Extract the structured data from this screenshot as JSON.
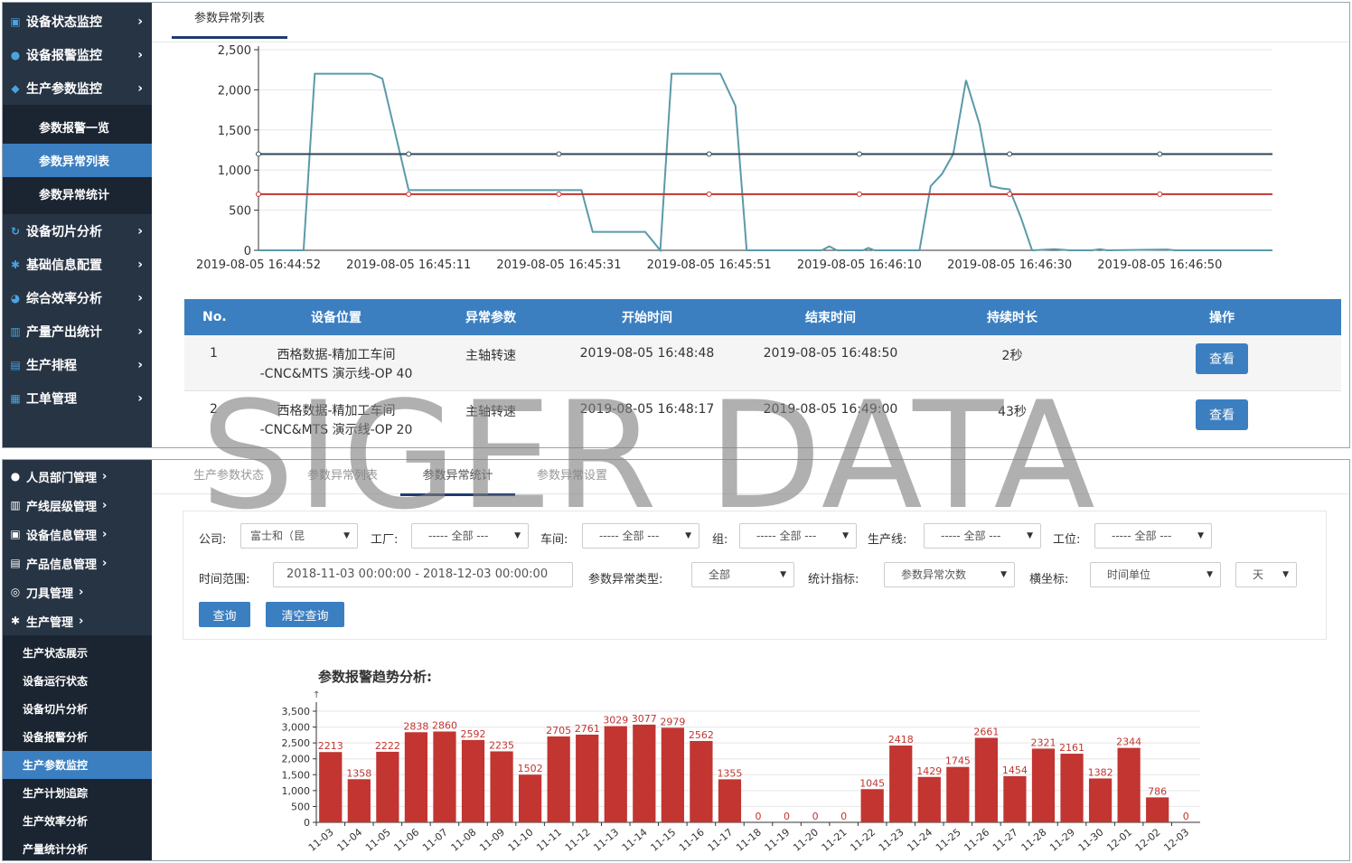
{
  "top": {
    "sidebar": {
      "items": [
        {
          "label": "设备状态监控"
        },
        {
          "label": "设备报警监控"
        },
        {
          "label": "生产参数监控"
        }
      ],
      "subitems": [
        {
          "label": "参数报警一览"
        },
        {
          "label": "参数异常列表"
        },
        {
          "label": "参数异常统计"
        }
      ],
      "items2": [
        {
          "label": "设备切片分析"
        },
        {
          "label": "基础信息配置"
        },
        {
          "label": "综合效率分析"
        },
        {
          "label": "产量产出统计"
        },
        {
          "label": "生产排程"
        },
        {
          "label": "工单管理"
        }
      ]
    },
    "tab": {
      "label": "参数异常列表"
    },
    "chart_data": {
      "type": "line",
      "y_ticks": [
        "2,500",
        "2,000",
        "1,500",
        "1,000",
        "500",
        "0"
      ],
      "ylim": [
        0,
        2500
      ],
      "x_ticks": [
        "2019-08-05 16:44:52",
        "2019-08-05 16:45:11",
        "2019-08-05 16:45:31",
        "2019-08-05 16:45:51",
        "2019-08-05 16:46:10",
        "2019-08-05 16:46:30",
        "2019-08-05 16:46:50"
      ],
      "series": [
        {
          "color": "#5b9aa8",
          "points": [
            [
              0,
              0
            ],
            [
              0.6,
              0
            ],
            [
              0.75,
              2200
            ],
            [
              1.5,
              2200
            ],
            [
              1.65,
              2140
            ],
            [
              2.0,
              750
            ],
            [
              4.3,
              750
            ],
            [
              4.45,
              230
            ],
            [
              5.15,
              230
            ],
            [
              5.35,
              0
            ],
            [
              5.5,
              2200
            ],
            [
              6.15,
              2200
            ],
            [
              6.35,
              1800
            ],
            [
              6.5,
              0
            ],
            [
              7.5,
              0
            ],
            [
              7.6,
              50
            ],
            [
              7.7,
              0
            ],
            [
              8.05,
              0
            ],
            [
              8.12,
              30
            ],
            [
              8.2,
              0
            ],
            [
              8.8,
              0
            ],
            [
              8.95,
              800
            ],
            [
              9.1,
              950
            ],
            [
              9.25,
              1200
            ],
            [
              9.42,
              2120
            ],
            [
              9.6,
              1570
            ],
            [
              9.75,
              800
            ],
            [
              9.9,
              770
            ],
            [
              10.0,
              760
            ],
            [
              10.15,
              410
            ],
            [
              10.3,
              0
            ],
            [
              10.6,
              15
            ],
            [
              10.8,
              0
            ],
            [
              11.1,
              0
            ],
            [
              11.2,
              15
            ],
            [
              11.3,
              0
            ],
            [
              12.1,
              10
            ],
            [
              12.2,
              0
            ],
            [
              13.5,
              0
            ]
          ]
        },
        {
          "color": "#2f4554",
          "flat": 1200
        },
        {
          "color": "#c23531",
          "flat": 700
        }
      ],
      "x_count": 13.5
    },
    "table": {
      "headers": [
        "No.",
        "设备位置",
        "异常参数",
        "开始时间",
        "结束时间",
        "持续时长",
        "操作"
      ],
      "rows": [
        {
          "no": "1",
          "loc1": "西格数据-精加工车间",
          "loc2": "-CNC&MTS 演示线-OP 40",
          "param": "主轴转速",
          "start": "2019-08-05 16:48:48",
          "end": "2019-08-05 16:48:50",
          "dur": "2秒",
          "action": "查看"
        },
        {
          "no": "2",
          "loc1": "西格数据-精加工车间",
          "loc2": "-CNC&MTS 演示线-OP 20",
          "param": "主轴转速",
          "start": "2019-08-05 16:48:17",
          "end": "2019-08-05 16:49:00",
          "dur": "43秒",
          "action": "查看"
        }
      ]
    }
  },
  "bottom": {
    "sidebar": {
      "items": [
        {
          "label": "人员部门管理"
        },
        {
          "label": "产线层级管理"
        },
        {
          "label": "设备信息管理"
        },
        {
          "label": "产品信息管理"
        },
        {
          "label": "刀具管理"
        },
        {
          "label": "生产管理"
        }
      ],
      "subitems": [
        {
          "label": "生产状态展示"
        },
        {
          "label": "设备运行状态"
        },
        {
          "label": "设备切片分析"
        },
        {
          "label": "设备报警分析"
        },
        {
          "label": "生产参数监控"
        },
        {
          "label": "生产计划追踪"
        },
        {
          "label": "生产效率分析"
        },
        {
          "label": "产量统计分析"
        }
      ]
    },
    "tabs": [
      "生产参数状态",
      "参数异常列表",
      "参数异常统计",
      "参数异常设置"
    ],
    "filters": {
      "company_label": "公司:",
      "company_value": "富士和（昆",
      "factory_label": "工厂:",
      "factory_value": "----- 全部 ---",
      "workshop_label": "车间:",
      "workshop_value": "----- 全部 ---",
      "group_label": "组:",
      "group_value": "----- 全部 ---",
      "line_label": "生产线:",
      "line_value": "----- 全部 ---",
      "station_label": "工位:",
      "station_value": "----- 全部 ---",
      "time_label": "时间范围:",
      "time_value": "2018-11-03 00:00:00 - 2018-12-03 00:00:00",
      "type_label": "参数异常类型:",
      "type_value": "全部",
      "metric_label": "统计指标:",
      "metric_value": "参数异常次数",
      "xaxis_label": "横坐标:",
      "xaxis_value": "时间单位",
      "unit_value": "天",
      "query": "查询",
      "clear": "清空查询"
    },
    "chart_data": {
      "type": "bar",
      "title": "参数报警趋势分析:",
      "ylim": [
        0,
        3500
      ],
      "y_ticks": [
        "3,500",
        "3,000",
        "2,500",
        "2,000",
        "1,500",
        "1,000",
        "500",
        "0"
      ],
      "color": "#c23531",
      "categories": [
        "11-03",
        "11-04",
        "11-05",
        "11-06",
        "11-07",
        "11-08",
        "11-09",
        "11-10",
        "11-11",
        "11-12",
        "11-13",
        "11-14",
        "11-15",
        "11-16",
        "11-17",
        "11-18",
        "11-19",
        "11-20",
        "11-21",
        "11-22",
        "11-23",
        "11-24",
        "11-25",
        "11-26",
        "11-27",
        "11-28",
        "11-29",
        "11-30",
        "12-01",
        "12-02",
        "12-03"
      ],
      "values": [
        2213,
        1358,
        2222,
        2838,
        2860,
        2592,
        2235,
        1502,
        2705,
        2761,
        3029,
        3077,
        2979,
        2562,
        1355,
        0,
        0,
        0,
        0,
        1045,
        2418,
        1429,
        1745,
        2661,
        1454,
        2321,
        2161,
        1382,
        2344,
        786,
        0
      ],
      "labels": [
        "2213",
        "1358",
        "2222",
        "2838",
        "2860",
        "2592",
        "2235",
        "1502",
        "2705",
        "2761",
        "3029",
        "3077",
        "2979",
        "2562",
        "1355",
        "0",
        "0",
        "0",
        "0",
        "1045",
        "2418",
        "1429",
        "1745",
        "2661",
        "1454",
        "2321",
        "2161",
        "1382",
        "2344",
        "786",
        "0"
      ]
    }
  },
  "watermark": "SIGER DATA"
}
